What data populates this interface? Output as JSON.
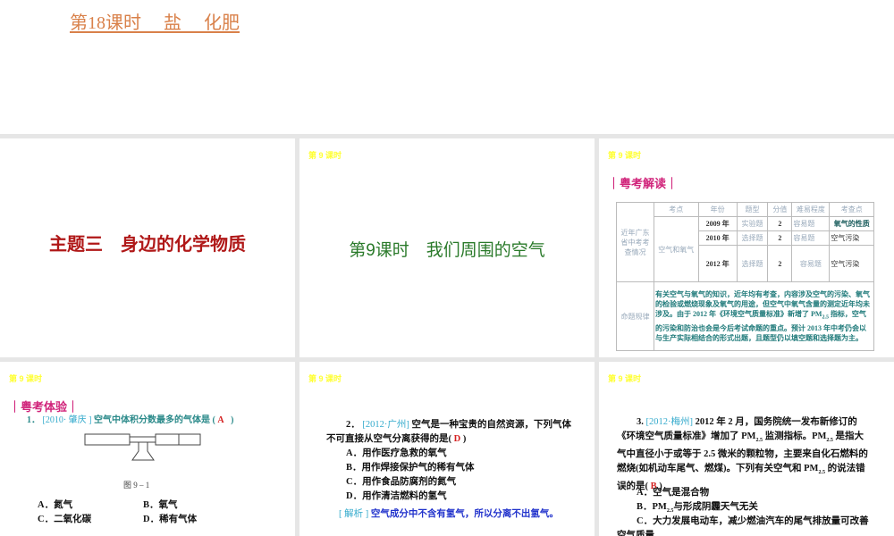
{
  "document": {
    "title": "第18课时　 盐　 化肥"
  },
  "slides": [
    {
      "title": "主题三　身边的化学物质"
    },
    {
      "lesson": "第 9 课时",
      "title": "第9课时　我们周围的空气"
    },
    {
      "lesson": "第 9 课时",
      "section": "｜粤考解读｜",
      "table": {
        "row_label_1": "近年广东省中考考查情况",
        "row_label_2": "命题规律",
        "topic": "空气和氧气",
        "headers": [
          "考点",
          "年份",
          "题型",
          "分值",
          "难易程度",
          "考查点"
        ],
        "rows": [
          [
            "2009 年",
            "实验题",
            "2",
            "容易题",
            "氧气的性质"
          ],
          [
            "2010 年",
            "选择题",
            "2",
            "容易题",
            "空气污染"
          ],
          [
            "2012 年",
            "选择题",
            "2",
            "容易题",
            "空气污染"
          ]
        ],
        "rule_a": "有关空气与氧气的知识，近年均有考查，内容涉及空气的污染、氧气的检验或燃烧现象及氧气的用途，但空气中氧气含量的测定近年均未涉及。由于 2012 年《环境空气质量标准》新增了 PM",
        "rule_sub": "2.5",
        "rule_b": " 指标，空气的污染和防治也会是今后考试命题的重点。预计 2013 年中考仍会以与生产实际相结合的形式出题，且题型仍以填空题和选择题为主。"
      }
    },
    {
      "lesson": "第 9 课时",
      "section": "｜粤考体验｜",
      "num": "1．",
      "source": "[2010· 肇庆 ]",
      "question": "空气中体积分数最多的气体是 (",
      "answer": "A",
      "close": ")",
      "figure": "图 9 – 1",
      "options": [
        "A．氮气",
        "B．氧气",
        "C．二氧化碳",
        "D．稀有气体"
      ]
    },
    {
      "lesson": "第 9 课时",
      "num": "2．",
      "source": "[2012·广州]",
      "question": "空气是一种宝贵的自然资源，下列气体不可直接从空气分离获得的是(",
      "answer": "D",
      "close": ")",
      "options": [
        "A．用作医疗急救的氧气",
        "B．用作焊接保护气的稀有气体",
        "C．用作食品防腐剂的氮气",
        "D．用作清洁燃料的氢气"
      ],
      "analysis_label": "[ 解析 ]",
      "analysis": "空气成分中不含有氢气，所以分离不出氢气。"
    },
    {
      "lesson": "第 9 课时",
      "num": "3.",
      "source": "[2012·梅州]",
      "q1": "2012 年 2 月，国务院统一发布新修订的《环境空气质量标准》增加了 PM",
      "q2": " 监测指标。PM",
      "q3": " 是指大气中直径小于或等于 2.5 微米的颗粒物，主要来自化石燃料的燃烧(如机动车尾气、燃煤)。下列有关空气和 PM",
      "q4": " 的说法错误的是(",
      "sub": "2.5",
      "answer": "B",
      "close": ")",
      "options": [
        "A．空气是混合物",
        "B．PM",
        "与形成阴霾天气无关",
        "C．大力发展电动车，减少燃油汽车的尾气排放量可改善空气质量"
      ]
    }
  ]
}
